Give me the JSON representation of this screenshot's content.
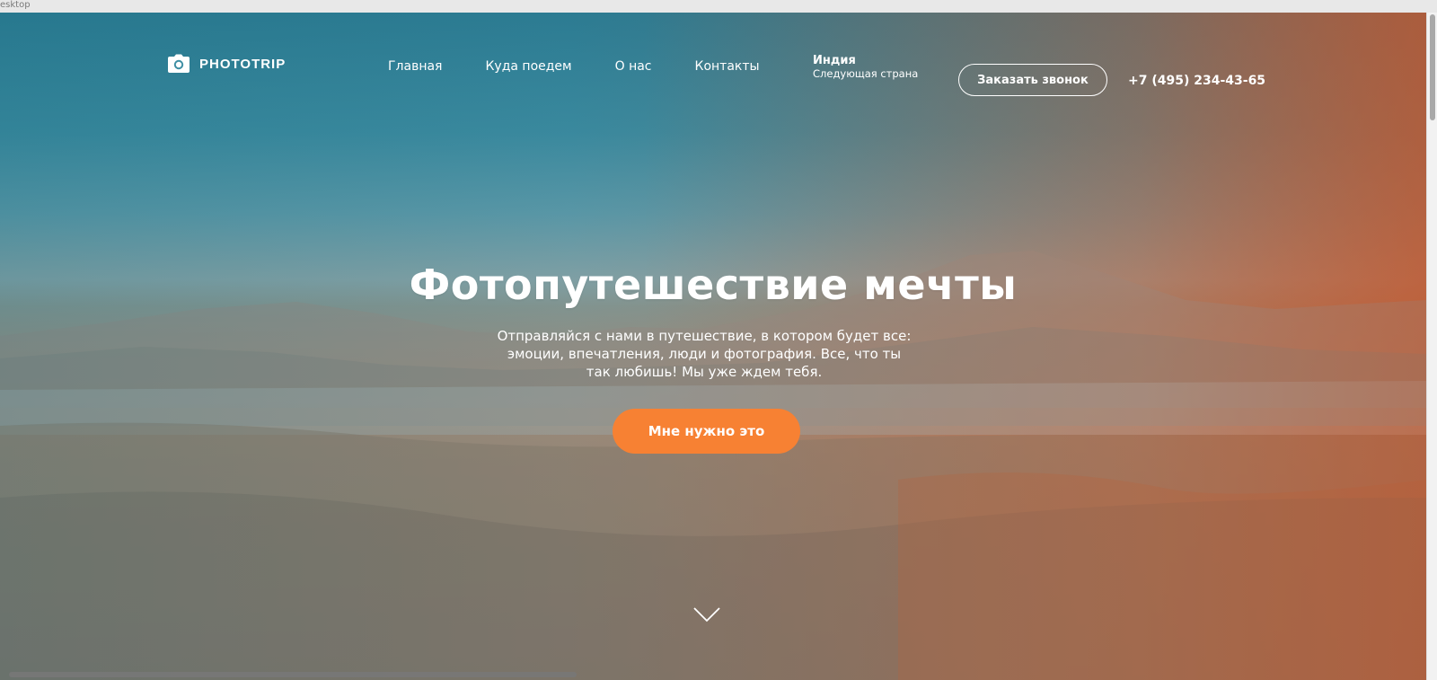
{
  "window": {
    "title": "esktop"
  },
  "header": {
    "logo_text": "PHOTOTRIP",
    "nav": [
      {
        "label": "Главная"
      },
      {
        "label": "Куда поедем"
      },
      {
        "label": "О нас"
      },
      {
        "label": "Контакты"
      }
    ],
    "next_country": {
      "name": "Индия",
      "label": "Следующая страна"
    },
    "call_button_label": "Заказать звонок",
    "phone": "+7 (495) 234-43-65"
  },
  "hero": {
    "title": "Фотопутешествие мечты",
    "subtitle": "Отправляйся с нами в путешествие, в котором будет все: эмоции, впечатления, люди и фотография. Все, что ты так любишь! Мы уже ждем тебя.",
    "cta_label": "Мне нужно это"
  },
  "colors": {
    "accent": "#f78133",
    "sky": "#2e7f96",
    "overlay_warm": "#d65a28"
  },
  "icons": {
    "logo": "camera-icon",
    "scroll": "chevron-down-icon"
  }
}
